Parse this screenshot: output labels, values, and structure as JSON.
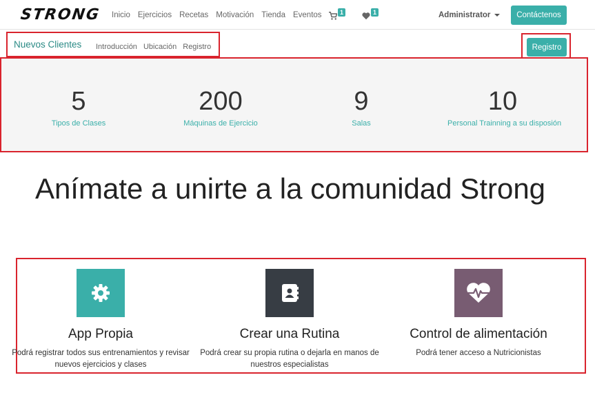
{
  "navbar": {
    "logo": "STRONG",
    "links": [
      "Inicio",
      "Ejercicios",
      "Recetas",
      "Motivación",
      "Tienda",
      "Eventos"
    ],
    "cart_count": "1",
    "wishlist_count": "1",
    "user": "Administrator",
    "contact_label": "Contáctenos"
  },
  "subnav": {
    "title": "Nuevos Clientes",
    "links": [
      "Introducción",
      "Ubicación",
      "Registro"
    ],
    "register_label": "Registro"
  },
  "stats": [
    {
      "number": "5",
      "label": "Tipos de Clases"
    },
    {
      "number": "200",
      "label": "Máquinas de Ejercicio"
    },
    {
      "number": "9",
      "label": "Salas"
    },
    {
      "number": "10",
      "label": "Personal Trainning a su disposión"
    }
  ],
  "headline": "Anímate a unirte a la comunidad Strong",
  "features": [
    {
      "icon": "gear-icon",
      "color": "#3aafa9",
      "title": "App Propia",
      "desc": "Podrá registrar todos sus entrenamientos y revisar nuevos ejercicios y clases"
    },
    {
      "icon": "address-book-icon",
      "color": "#373d44",
      "title": "Crear una Rutina",
      "desc": "Podrá crear su propia rutina o dejarla en manos de nuestros especialistas"
    },
    {
      "icon": "heartbeat-icon",
      "color": "#785c72",
      "title": "Control de alimentación",
      "desc": "Podrá tener acceso a Nutricionistas"
    }
  ],
  "colors": {
    "accent": "#3aafa9",
    "highlight_border": "#d9232d"
  }
}
